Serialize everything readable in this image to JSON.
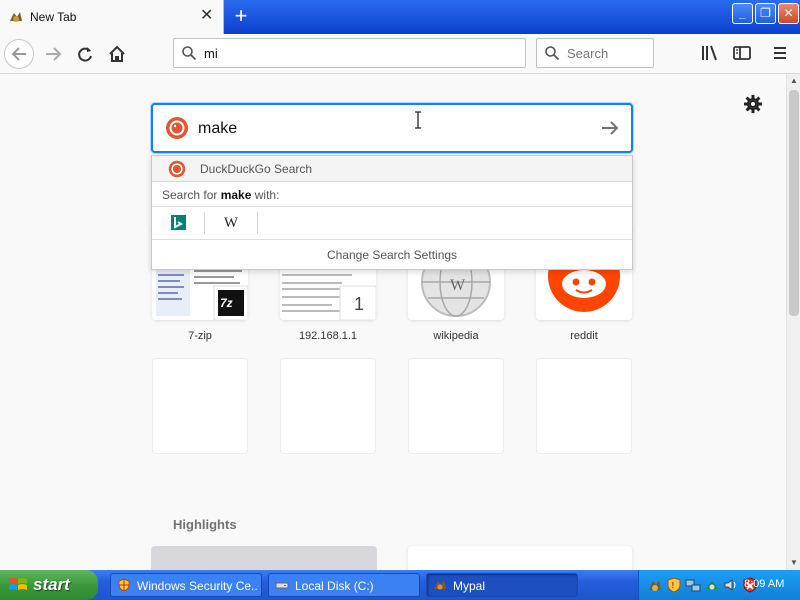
{
  "browser": {
    "tab_title": "New Tab",
    "url_value": "mi",
    "search_placeholder": "Search"
  },
  "search": {
    "value": "make",
    "engine_name": "DuckDuckGo Search",
    "search_for_prefix": "Search for",
    "search_term": "make",
    "search_for_suffix": "with:",
    "wiki_label": "W",
    "change_settings": "Change Search Settings"
  },
  "top_sites": [
    {
      "label": "7-zip",
      "badge": "7z"
    },
    {
      "label": "192.168.1.1",
      "badge": "1"
    },
    {
      "label": "wikipedia"
    },
    {
      "label": "reddit"
    }
  ],
  "highlights": {
    "title": "Highlights"
  },
  "taskbar": {
    "start_label": "start",
    "tasks": [
      {
        "label": "Windows Security Ce..."
      },
      {
        "label": "Local Disk (C:)"
      },
      {
        "label": "Mypal"
      }
    ],
    "clock": "8:09 AM"
  },
  "colors": {
    "accent": "#0a84ff",
    "reddit": "#ff4500",
    "bing": "#008373",
    "ddg": "#de5833"
  }
}
